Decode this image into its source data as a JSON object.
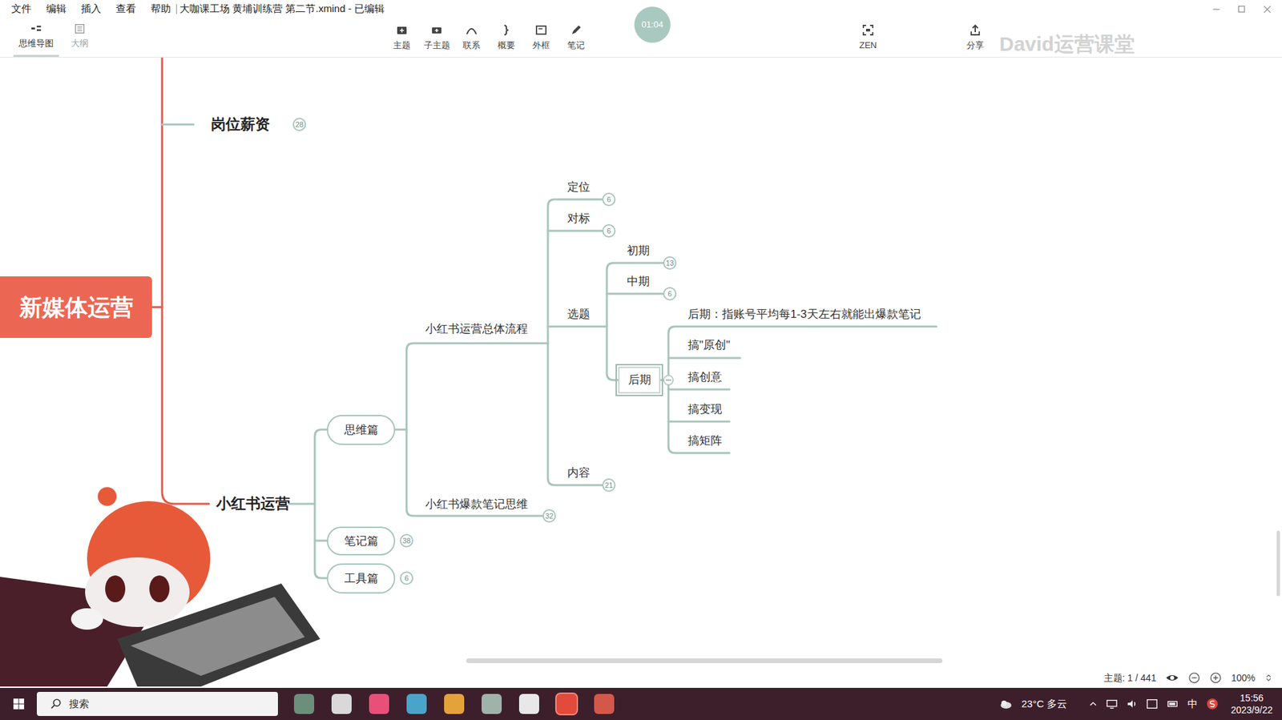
{
  "window": {
    "title": "大咖课工场 黄埔训练营 第二节.xmind - 已编辑"
  },
  "menu": [
    "文件",
    "编辑",
    "插入",
    "查看",
    "帮助"
  ],
  "view_tabs": [
    {
      "label": "思维导图",
      "selected": true
    },
    {
      "label": "大纲",
      "selected": false
    }
  ],
  "toolbar": [
    "主题",
    "子主题",
    "联系",
    "概要",
    "外框",
    "笔记"
  ],
  "timer": "01:04",
  "right_tools": [
    "ZEN",
    "分享"
  ],
  "watermark": "David运营课堂",
  "map": {
    "nodes": [
      {
        "label": "新媒体运营",
        "kind": "root",
        "selected": false
      },
      {
        "label": "岗位薪资",
        "kind": "branch",
        "count": "28",
        "selected": false
      },
      {
        "label": "小红书运营",
        "kind": "branch",
        "selected": false
      },
      {
        "label": "思维篇",
        "kind": "pill",
        "selected": false
      },
      {
        "label": "笔记篇",
        "kind": "pill",
        "count": "38",
        "selected": false
      },
      {
        "label": "工具篇",
        "kind": "pill",
        "count": "6",
        "selected": false
      },
      {
        "label": "小红书运营总体流程",
        "kind": "plain",
        "selected": false
      },
      {
        "label": "小红书爆款笔记思维",
        "kind": "plain",
        "count": "32",
        "selected": false
      },
      {
        "label": "定位",
        "kind": "plain",
        "count": "6",
        "selected": false
      },
      {
        "label": "对标",
        "kind": "plain",
        "count": "6",
        "selected": false
      },
      {
        "label": "选题",
        "kind": "plain",
        "selected": false
      },
      {
        "label": "内容",
        "kind": "plain",
        "count": "21",
        "selected": false
      },
      {
        "label": "初期",
        "kind": "plain",
        "count": "13",
        "selected": false
      },
      {
        "label": "中期",
        "kind": "plain",
        "count": "6",
        "selected": false
      },
      {
        "label": "后期",
        "kind": "box",
        "selected": true
      },
      {
        "label": "后期：指账号平均每1-3天左右就能出爆款笔记",
        "kind": "plain",
        "selected": false
      },
      {
        "label": "搞\"原创\"",
        "kind": "plain",
        "selected": false
      },
      {
        "label": "搞创意",
        "kind": "plain",
        "selected": false
      },
      {
        "label": "搞变现",
        "kind": "plain",
        "selected": false
      },
      {
        "label": "搞矩阵",
        "kind": "plain",
        "selected": false
      }
    ]
  },
  "status_bar": {
    "topics": "主题: 1 / 441",
    "zoom": "100%"
  },
  "taskbar": {
    "search": "搜索",
    "weather": "23°C 多云",
    "ime": "中",
    "time": "15:56",
    "date": "2023/9/22"
  }
}
